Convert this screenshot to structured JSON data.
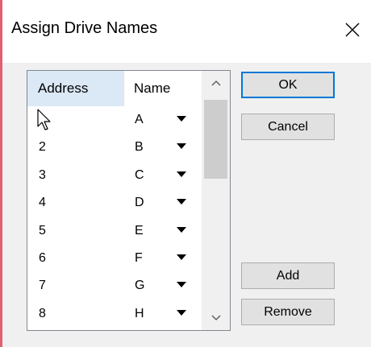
{
  "window": {
    "title": "Assign Drive Names",
    "close_icon": "close-icon"
  },
  "list": {
    "columns": [
      "Address",
      "Name"
    ],
    "rows": [
      {
        "address": "",
        "name": "A"
      },
      {
        "address": "2",
        "name": "B"
      },
      {
        "address": "3",
        "name": "C"
      },
      {
        "address": "4",
        "name": "D"
      },
      {
        "address": "5",
        "name": "E"
      },
      {
        "address": "6",
        "name": "F"
      },
      {
        "address": "7",
        "name": "G"
      },
      {
        "address": "8",
        "name": "H"
      }
    ]
  },
  "buttons": {
    "ok": "OK",
    "cancel": "Cancel",
    "add": "Add",
    "remove": "Remove"
  },
  "colors": {
    "header_selected": "#dbe8f6",
    "default_button_border": "#0078d7",
    "window_accent": "#e06070"
  }
}
